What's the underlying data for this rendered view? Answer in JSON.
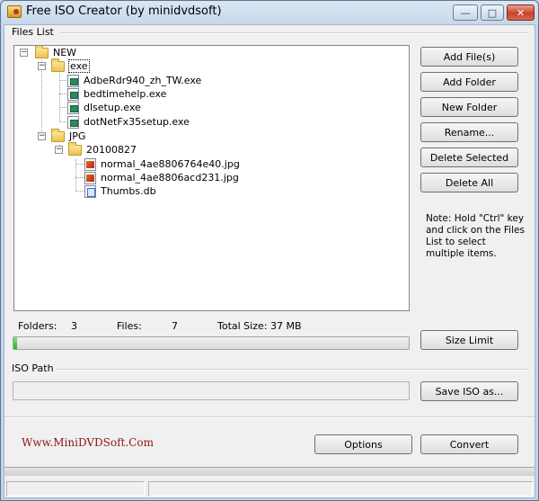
{
  "window": {
    "title": "Free ISO Creator (by minidvdsoft)",
    "controls": {
      "minimize": "—",
      "maximize": "□",
      "close": "✕"
    }
  },
  "files_list": {
    "label": "Files List",
    "tree": {
      "root": "NEW",
      "exe_folder": "exe",
      "exe_files": [
        "AdbeRdr940_zh_TW.exe",
        "bedtimehelp.exe",
        "dlsetup.exe",
        "dotNetFx35setup.exe"
      ],
      "jpg_folder": "JPG",
      "sub_folder": "20100827",
      "jpg_files": [
        "normal_4ae8806764e40.jpg",
        "normal_4ae8806acd231.jpg",
        "Thumbs.db"
      ],
      "expander_symbol": "−"
    }
  },
  "buttons": {
    "add_files": "Add File(s)",
    "add_folder": "Add Folder",
    "new_folder": "New Folder",
    "rename": "Rename...",
    "delete_selected": "Delete Selected",
    "delete_all": "Delete All",
    "size_limit": "Size Limit",
    "save_iso": "Save ISO as...",
    "options": "Options",
    "convert": "Convert"
  },
  "note": "Note: Hold \"Ctrl\" key and click on the Files List to select multiple items.",
  "stats": {
    "folders_label": "Folders:",
    "folders_value": "3",
    "files_label": "Files:",
    "files_value": "7",
    "size_label": "Total Size:",
    "size_value": "37 MB"
  },
  "progress": {
    "fraction": 0.01
  },
  "iso_path": {
    "label": "ISO Path",
    "value": ""
  },
  "site_link": "Www.MiniDVDSoft.Com",
  "colors": {
    "progress_fill": "#2bb32b",
    "link": "#8a1616",
    "title_bar": "#c7d7ea"
  }
}
